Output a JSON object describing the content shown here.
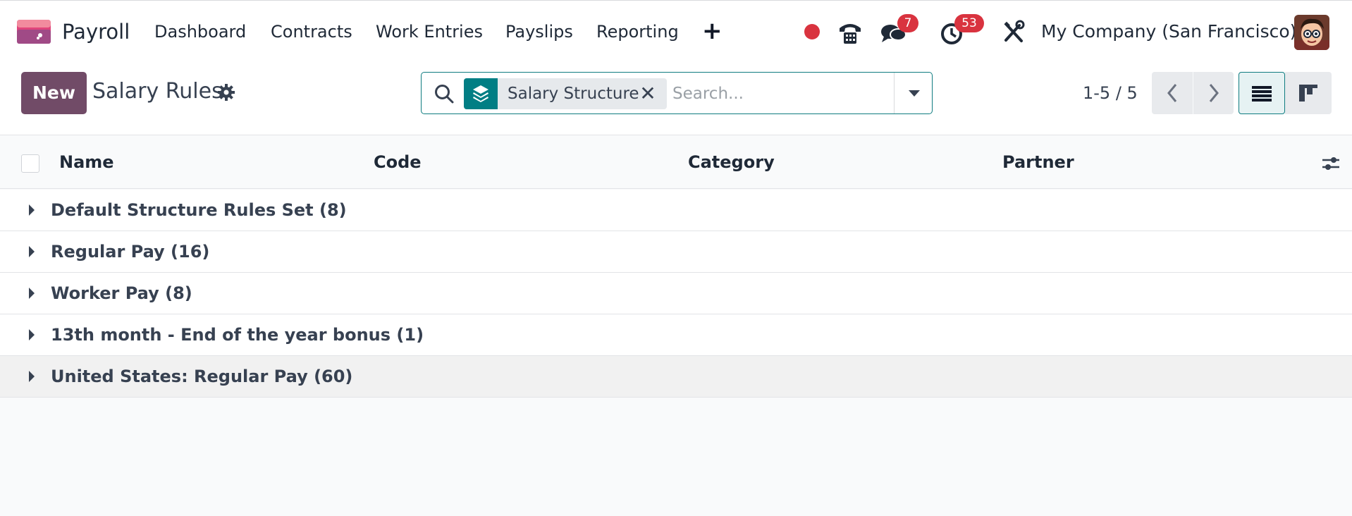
{
  "navbar": {
    "app_name": "Payroll",
    "menu": [
      "Dashboard",
      "Contracts",
      "Work Entries",
      "Payslips",
      "Reporting"
    ],
    "plus_label": "+",
    "messages_count": "7",
    "activities_count": "53",
    "company": "My Company (San Francisco)"
  },
  "control": {
    "new_label": "New",
    "title": "Salary Rules",
    "search": {
      "facet_label": "Salary Structure",
      "placeholder": "Search..."
    },
    "pager": "1-5 / 5"
  },
  "list": {
    "columns": [
      "Name",
      "Code",
      "Category",
      "Partner"
    ],
    "groups": [
      {
        "label": "Default Structure Rules Set (8)"
      },
      {
        "label": "Regular Pay (16)"
      },
      {
        "label": "Worker Pay (8)"
      },
      {
        "label": "13th month - End of the year bonus (1)"
      },
      {
        "label": "United States: Regular Pay (60)"
      }
    ]
  },
  "colors": {
    "brand": "#714b67",
    "accent": "#017e84",
    "badge": "#d9333f"
  }
}
